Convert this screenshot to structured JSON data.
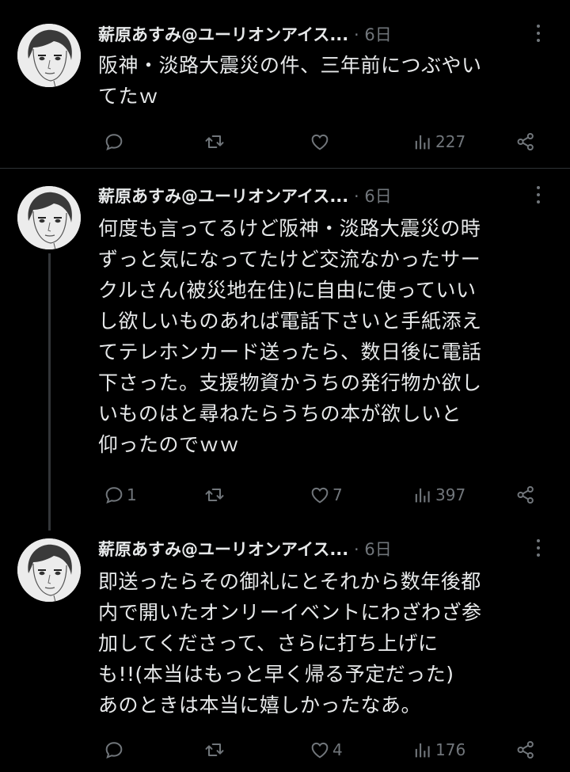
{
  "tweets": [
    {
      "author": "薪原あすみ@ユーリオンアイス...",
      "separator": "·",
      "time": "6日",
      "lines": [
        "阪神・淡路大震災の件、三年前につぶやい",
        "てたｗ"
      ],
      "replies": "",
      "retweets": "",
      "likes": "",
      "views": "227"
    },
    {
      "author": "薪原あすみ@ユーリオンアイス...",
      "separator": "·",
      "time": "6日",
      "lines": [
        "何度も言ってるけど阪神・淡路大震災の時",
        "ずっと気になってたけど交流なかったサー",
        "クルさん(被災地在住)に自由に使っていい",
        "し欲しいものあれば電話下さいと手紙添え",
        "てテレホンカード送ったら、数日後に電話",
        "下さった。支援物資かうちの発行物か欲し",
        "いものはと尋ねたらうちの本が欲しいと",
        "仰ったのでｗｗ"
      ],
      "replies": "1",
      "retweets": "",
      "likes": "7",
      "views": "397"
    },
    {
      "author": "薪原あすみ@ユーリオンアイス...",
      "separator": "·",
      "time": "6日",
      "lines": [
        "即送ったらその御礼にとそれから数年後都",
        "内で開いたオンリーイベントにわざわざ参",
        "加してくださって、さらに打ち上げに",
        "も!!(本当はもっと早く帰る予定だった)",
        "あのときは本当に嬉しかったなあ。"
      ],
      "replies": "",
      "retweets": "",
      "likes": "4",
      "views": "176"
    }
  ],
  "icons": {
    "reply": "reply-icon",
    "retweet": "retweet-icon",
    "like": "heart-icon",
    "views": "views-chart-icon",
    "share": "share-icon",
    "more": "more-options-icon"
  },
  "colors": {
    "background": "#000000",
    "text": "#e7e9ea",
    "secondary": "#71767b",
    "divider": "#2f3336"
  }
}
